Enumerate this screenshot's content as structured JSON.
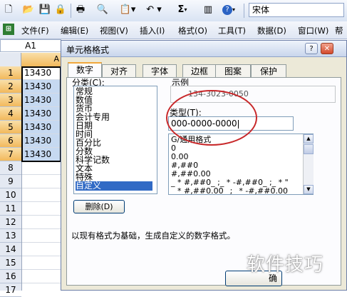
{
  "toolbar": {
    "buttons": [
      "new-icon",
      "open-icon",
      "save-icon",
      "permission-icon",
      "print-icon",
      "research-icon",
      "paste-icon",
      "undo-icon",
      "sum-icon",
      "chart-icon",
      "help-icon"
    ],
    "sum_symbol": "Σ",
    "font_name": "宋体"
  },
  "menubar": {
    "items": [
      "文件(F)",
      "编辑(E)",
      "视图(V)",
      "插入(I)",
      "格式(O)",
      "工具(T)",
      "数据(D)",
      "窗口(W)",
      "帮"
    ]
  },
  "sheet": {
    "name_box": "A1",
    "column_a": "A",
    "rows": [
      "1",
      "2",
      "3",
      "4",
      "5",
      "6",
      "7",
      "8",
      "9",
      "10",
      "11",
      "12",
      "13",
      "14",
      "15",
      "16",
      "17"
    ],
    "cells": [
      "13430",
      "13430",
      "13430",
      "13430",
      "13430",
      "13430",
      "13430"
    ]
  },
  "dialog": {
    "title": "单元格格式",
    "help_btn": "?",
    "close_btn": "✕",
    "tabs": [
      "数字",
      "对齐",
      "字体",
      "边框",
      "图案",
      "保护"
    ],
    "category_label": "分类(C):",
    "categories": [
      "常规",
      "数值",
      "货币",
      "会计专用",
      "日期",
      "时间",
      "百分比",
      "分数",
      "科学记数",
      "文本",
      "特殊",
      "自定义"
    ],
    "selected_category": "自定义",
    "sample_label": "示例",
    "sample_value": "134-3023-0050",
    "type_label": "类型(T):",
    "type_value": "000-0000-0000",
    "format_list": [
      "G/通用格式",
      "0",
      "0.00",
      "#,##0",
      "#,##0.00",
      "_ * #,##0_ ;_ * -#,##0_ ;_ * \"",
      "_ * #,##0.00_ ;_ * -#,##0.00_"
    ],
    "delete_button": "删除(D)",
    "description": "以现有格式为基础，生成自定义的数字格式。",
    "ok_button": "确"
  },
  "watermark": "软件技巧",
  "colors": {
    "selection_fill": "#c6d9f1",
    "active_header": "#f2b95c",
    "annotation": "#c8282a",
    "list_highlight": "#316ac5"
  }
}
